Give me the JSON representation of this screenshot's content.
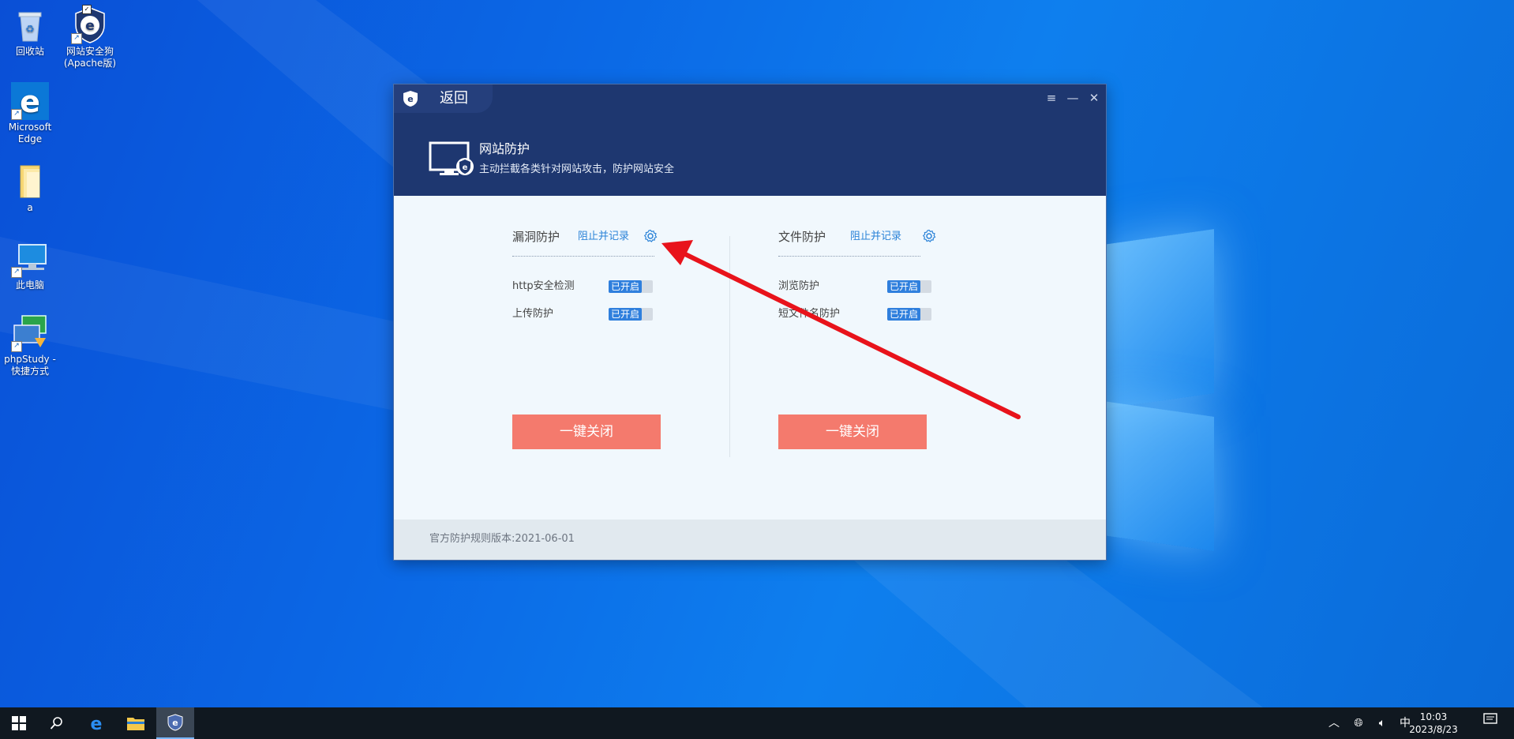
{
  "desktop": {
    "icons": [
      {
        "label": "回收站"
      },
      {
        "label": "网站安全狗\n(Apache版)"
      },
      {
        "label": "Microsoft\nEdge"
      },
      {
        "label": "a"
      },
      {
        "label": "此电脑"
      },
      {
        "label": "phpStudy -\n快捷方式"
      }
    ]
  },
  "app": {
    "back_label": "返回",
    "header": {
      "title": "网站防护",
      "subtitle": "主动拦截各类针对网站攻击，防护网站安全"
    },
    "columns": [
      {
        "title": "漏洞防护",
        "mode_link": "阻止并记录",
        "rows": [
          {
            "label": "http安全检测",
            "status": "已开启"
          },
          {
            "label": "上传防护",
            "status": "已开启"
          }
        ],
        "button": "一键关闭"
      },
      {
        "title": "文件防护",
        "mode_link": "阻止并记录",
        "rows": [
          {
            "label": "浏览防护",
            "status": "已开启"
          },
          {
            "label": "短文件名防护",
            "status": "已开启"
          }
        ],
        "button": "一键关闭"
      }
    ],
    "footer": "官方防护规则版本:2021-06-01"
  },
  "taskbar": {
    "tray": {
      "ime": "中"
    },
    "clock": {
      "time": "10:03",
      "date": "2023/8/23"
    }
  },
  "colors": {
    "header_bg": "#1e3770",
    "accent_blue": "#2f7fdd",
    "button_red": "#f47a6d",
    "annotation_arrow": "#e8131b"
  }
}
